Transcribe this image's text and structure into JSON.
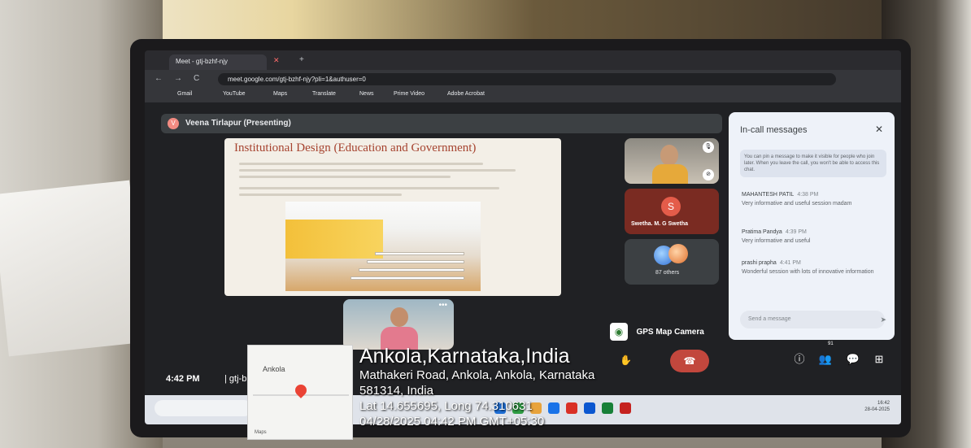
{
  "browser": {
    "tab_title": "Meet - gtj-bzhf-njy",
    "tab_close": "✕",
    "new_tab": "+",
    "url": "meet.google.com/gtj-bzhf-njy?pli=1&authuser=0",
    "bookmarks": [
      "Gmail",
      "YouTube",
      "Maps",
      "Translate",
      "News",
      "Prime Video",
      "Adobe Acrobat"
    ]
  },
  "meet": {
    "presenting": "Veena Tirlapur (Presenting)",
    "slide_title": "Institutional Design (Education and Government)",
    "participants": {
      "tile2_initial": "S",
      "tile2_name": "Swetha. M. G Swetha",
      "others": "87 others"
    },
    "time": "4:42 PM",
    "code_prefix": "| gtj-b",
    "people_count": "91",
    "more": "•••"
  },
  "chat": {
    "title": "In-call messages",
    "close": "✕",
    "notice": "You can pin a message to make it visible for people who join later. When you leave the call, you won't be able to access this chat.",
    "messages": [
      {
        "author": "MAHANTESH PATIL",
        "time": "4:38 PM",
        "text": "Very informative and useful session madam"
      },
      {
        "author": "Pratima Pandya",
        "time": "4:39 PM",
        "text": "Very informative and useful"
      },
      {
        "author": "prashi prapha",
        "time": "4:41 PM",
        "text": "Wonderful session with lots of innovative information"
      }
    ],
    "input_placeholder": "Send a message"
  },
  "gps_camera": {
    "label": "GPS Map Camera",
    "map_city": "Ankola",
    "map_logo": "Maps",
    "title": "Ankola,Karnataka,India",
    "address_line1": "Mathakeri Road, Ankola, Ankola, Karnataka",
    "address_line2": "581314, India",
    "coordinates": "Lat 14.655695, Long 74.310631",
    "datetime": "04/28/2025 04:42 PM GMT+05:30"
  },
  "taskbar": {
    "clock_time": "16:42",
    "clock_date": "28-04-2025"
  },
  "icons": {
    "back": "←",
    "forward": "→",
    "reload": "C",
    "mic": "🎙",
    "pin": "⊘",
    "info": "ⓘ",
    "people": "👥",
    "chat": "💬",
    "activities": "⊞",
    "raise_hand": "✋",
    "end_call": "☎",
    "gps": "◉",
    "send": "➤"
  }
}
